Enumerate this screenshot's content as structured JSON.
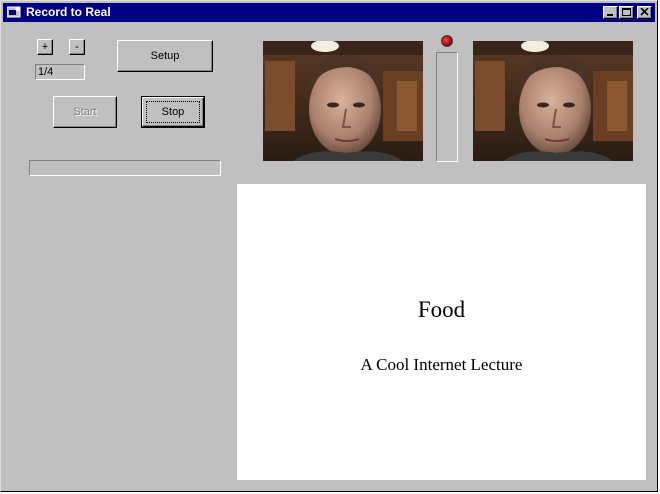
{
  "window": {
    "title": "Record to Real",
    "controls": {
      "minimize_icon": "minimize-icon",
      "maximize_icon": "maximize-icon",
      "close_icon": "close-icon"
    }
  },
  "slide_nav": {
    "plus_label": "+",
    "minus_label": "-",
    "counter_value": "1/4"
  },
  "buttons": {
    "setup_label": "Setup",
    "start_label": "Start",
    "stop_label": "Stop"
  },
  "status": {
    "recording_indicator": "recording-led-icon",
    "recording_color": "#cc0000",
    "progress_percent": 0,
    "level_percent": 0
  },
  "video": {
    "preview_left": "webcam-preview",
    "preview_right": "encoded-output-preview"
  },
  "slide": {
    "title": "Food",
    "subtitle": "A Cool Internet Lecture"
  },
  "colors": {
    "titlebar": "#000080",
    "window_face": "#c0c0c0",
    "slide_background": "#ffffff"
  }
}
